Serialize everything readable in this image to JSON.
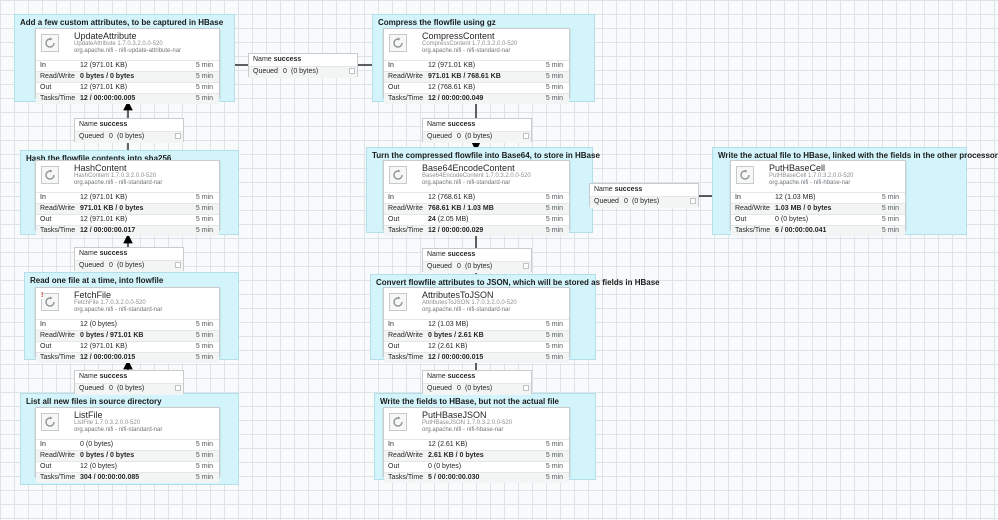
{
  "stat_labels": {
    "in": "In",
    "read_write": "Read/Write",
    "out": "Out",
    "tasks_time": "Tasks/Time"
  },
  "conn_labels": {
    "name": "Name",
    "queued": "Queued"
  },
  "labels": [
    "Add a few custom attributes, to be captured in HBase",
    "Compress the flowfile using gz",
    "Hash the flowfile contents into sha256",
    "Turn the compressed flowfile into Base64, to store in HBase",
    "Write the actual file to HBase, linked with the fields in the other processor",
    "Read one file at a time, into flowfile",
    "Convert flowfile attributes to JSON, which will be stored as fields in HBase",
    "List all new files in source directory",
    "Write the fields to HBase, but not the actual file"
  ],
  "processors": [
    {
      "name": "UpdateAttribute",
      "type": "UpdateAttribute 1.7.0.3.2.0.0-520",
      "bundle": "org.apache.nifi - nifi-update-attribute-nar",
      "in_count": "12",
      "in_size": "(971.01 KB)",
      "rw": "0 bytes / 0 bytes",
      "out_count": "12",
      "out_size": "(971.01 KB)",
      "tasks": "12 / 00:00:00.005",
      "time": "5 min"
    },
    {
      "name": "CompressContent",
      "type": "CompressContent 1.7.0.3.2.0.0-520",
      "bundle": "org.apache.nifi - nifi-standard-nar",
      "in_count": "12",
      "in_size": "(971.01 KB)",
      "rw": "971.01 KB / 768.61 KB",
      "out_count": "12",
      "out_size": "(768.61 KB)",
      "tasks": "12 / 00:00:00.049",
      "time": "5 min"
    },
    {
      "name": "HashContent",
      "type": "HashContent 1.7.0.3.2.0.0-520",
      "bundle": "org.apache.nifi - nifi-standard-nar",
      "in_count": "12",
      "in_size": "(971.01 KB)",
      "rw": "971.01 KB / 0 bytes",
      "out_count": "12",
      "out_size": "(971.01 KB)",
      "tasks": "12 / 00:00:00.017",
      "time": "5 min"
    },
    {
      "name": "Base64EncodeContent",
      "type": "Base64EncodeContent 1.7.0.3.2.0.0-520",
      "bundle": "org.apache.nifi - nifi-standard-nar",
      "in_count": "12",
      "in_size": "(768.61 KB)",
      "rw": "768.61 KB / 1.03 MB",
      "out_count": "24",
      "out_size": "(2.05 MB)",
      "tasks": "12 / 00:00:00.029",
      "time": "5 min"
    },
    {
      "name": "PutHBaseCell",
      "type": "PutHBaseCell 1.7.0.3.2.0.0-520",
      "bundle": "org.apache.nifi - nifi-hbase-nar",
      "in_count": "12",
      "in_size": "(1.03 MB)",
      "rw": "1.03 MB / 0 bytes",
      "out_count": "0",
      "out_size": "(0 bytes)",
      "tasks": "6 / 00:00:00.041",
      "time": "5 min"
    },
    {
      "name": "FetchFile",
      "type": "FetchFile 1.7.0.3.2.0.0-520",
      "bundle": "org.apache.nifi - nifi-standard-nar",
      "in_count": "12",
      "in_size": "(0 bytes)",
      "rw": "0 bytes / 971.01 KB",
      "out_count": "12",
      "out_size": "(971.01 KB)",
      "tasks": "12 / 00:00:00.015",
      "time": "5 min"
    },
    {
      "name": "AttributesToJSON",
      "type": "AttributesToJSON 1.7.0.3.2.0.0-520",
      "bundle": "org.apache.nifi - nifi-standard-nar",
      "in_count": "12",
      "in_size": "(1.03 MB)",
      "rw": "0 bytes / 2.61 KB",
      "out_count": "12",
      "out_size": "(2.61 KB)",
      "tasks": "12 / 00:00:00.015",
      "time": "5 min"
    },
    {
      "name": "ListFile",
      "type": "ListFile 1.7.0.3.2.0.0-520",
      "bundle": "org.apache.nifi - nifi-standard-nar",
      "in_count": "0",
      "in_size": "(0 bytes)",
      "rw": "0 bytes / 0 bytes",
      "out_count": "12",
      "out_size": "(0 bytes)",
      "tasks": "304 / 00:00:00.085",
      "time": "5 min"
    },
    {
      "name": "PutHBaseJSON",
      "type": "PutHBaseJSON 1.7.0.3.2.0.0-520",
      "bundle": "org.apache.nifi - nifi-hbase-nar",
      "in_count": "12",
      "in_size": "(2.61 KB)",
      "rw": "2.61 KB / 0 bytes",
      "out_count": "0",
      "out_size": "(0 bytes)",
      "tasks": "5 / 00:00:00.030",
      "time": "5 min"
    }
  ],
  "connections": [
    {
      "name": "success",
      "queued_count": "0",
      "queued_size": "(0 bytes)"
    },
    {
      "name": "success",
      "queued_count": "0",
      "queued_size": "(0 bytes)"
    },
    {
      "name": "success",
      "queued_count": "0",
      "queued_size": "(0 bytes)"
    },
    {
      "name": "success",
      "queued_count": "0",
      "queued_size": "(0 bytes)"
    },
    {
      "name": "success",
      "queued_count": "0",
      "queued_size": "(0 bytes)"
    },
    {
      "name": "success",
      "queued_count": "0",
      "queued_size": "(0 bytes)"
    },
    {
      "name": "success",
      "queued_count": "0",
      "queued_size": "(0 bytes)"
    },
    {
      "name": "success",
      "queued_count": "0",
      "queued_size": "(0 bytes)"
    }
  ]
}
